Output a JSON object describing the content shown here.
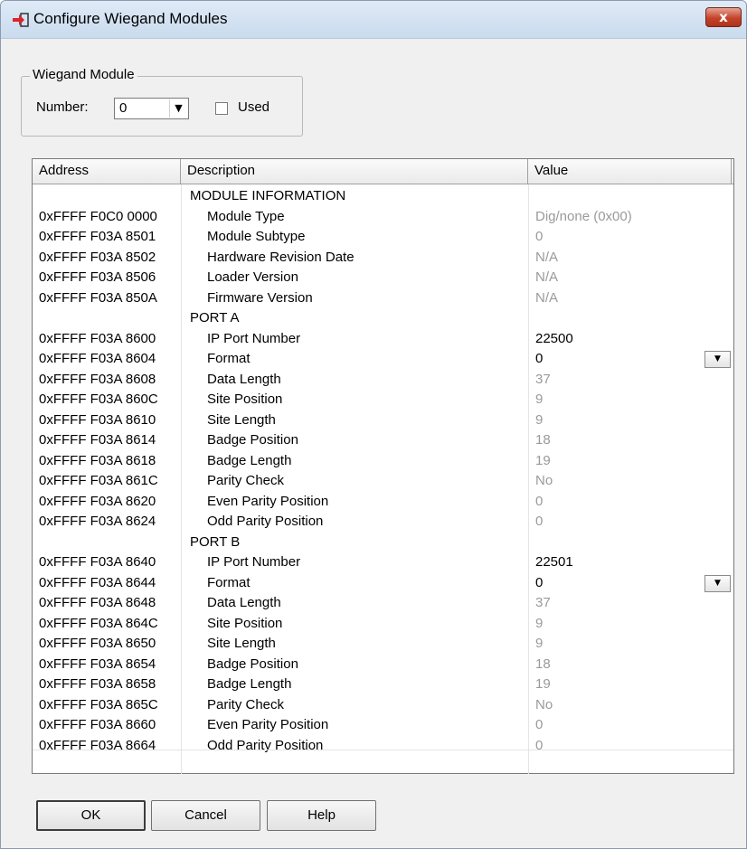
{
  "window": {
    "title": "Configure Wiegand Modules",
    "close_glyph": "x"
  },
  "module_group": {
    "title": "Wiegand Module",
    "number_label": "Number:",
    "number_value": "0",
    "used_label": "Used",
    "used_checked": false
  },
  "grid": {
    "headers": [
      "Address",
      "Description",
      "Value"
    ],
    "rows": [
      {
        "address": "",
        "description": "MODULE INFORMATION",
        "value": "",
        "type": "section"
      },
      {
        "address": "0xFFFF F0C0 0000",
        "description": "Module Type",
        "value": "Dig/none (0x00)",
        "type": "readonly"
      },
      {
        "address": "0xFFFF F03A 8501",
        "description": "Module Subtype",
        "value": "0",
        "type": "readonly"
      },
      {
        "address": "0xFFFF F03A 8502",
        "description": "Hardware Revision Date",
        "value": "N/A",
        "type": "readonly"
      },
      {
        "address": "0xFFFF F03A 8506",
        "description": "Loader Version",
        "value": "N/A",
        "type": "readonly"
      },
      {
        "address": "0xFFFF F03A 850A",
        "description": "Firmware Version",
        "value": "N/A",
        "type": "readonly"
      },
      {
        "address": "",
        "description": "PORT A",
        "value": "",
        "type": "section"
      },
      {
        "address": "0xFFFF F03A 8600",
        "description": "IP Port Number",
        "value": "22500",
        "type": "editable"
      },
      {
        "address": "0xFFFF F03A 8604",
        "description": "Format",
        "value": "0",
        "type": "dropdown"
      },
      {
        "address": "0xFFFF F03A 8608",
        "description": "Data Length",
        "value": "37",
        "type": "readonly"
      },
      {
        "address": "0xFFFF F03A 860C",
        "description": "Site Position",
        "value": "9",
        "type": "readonly"
      },
      {
        "address": "0xFFFF F03A 8610",
        "description": "Site Length",
        "value": "9",
        "type": "readonly"
      },
      {
        "address": "0xFFFF F03A 8614",
        "description": "Badge Position",
        "value": "18",
        "type": "readonly"
      },
      {
        "address": "0xFFFF F03A 8618",
        "description": "Badge Length",
        "value": "19",
        "type": "readonly"
      },
      {
        "address": "0xFFFF F03A 861C",
        "description": "Parity Check",
        "value": "No",
        "type": "readonly"
      },
      {
        "address": "0xFFFF F03A 8620",
        "description": "Even Parity Position",
        "value": "0",
        "type": "readonly"
      },
      {
        "address": "0xFFFF F03A 8624",
        "description": "Odd Parity Position",
        "value": "0",
        "type": "readonly"
      },
      {
        "address": "",
        "description": "PORT B",
        "value": "",
        "type": "section"
      },
      {
        "address": "0xFFFF F03A 8640",
        "description": "IP Port Number",
        "value": "22501",
        "type": "editable"
      },
      {
        "address": "0xFFFF F03A 8644",
        "description": "Format",
        "value": "0",
        "type": "dropdown"
      },
      {
        "address": "0xFFFF F03A 8648",
        "description": "Data Length",
        "value": "37",
        "type": "readonly"
      },
      {
        "address": "0xFFFF F03A 864C",
        "description": "Site Position",
        "value": "9",
        "type": "readonly"
      },
      {
        "address": "0xFFFF F03A 8650",
        "description": "Site Length",
        "value": "9",
        "type": "readonly"
      },
      {
        "address": "0xFFFF F03A 8654",
        "description": "Badge Position",
        "value": "18",
        "type": "readonly"
      },
      {
        "address": "0xFFFF F03A 8658",
        "description": "Badge Length",
        "value": "19",
        "type": "readonly"
      },
      {
        "address": "0xFFFF F03A 865C",
        "description": "Parity Check",
        "value": "No",
        "type": "readonly"
      },
      {
        "address": "0xFFFF F03A 8660",
        "description": "Even Parity Position",
        "value": "0",
        "type": "readonly"
      },
      {
        "address": "0xFFFF F03A 8664",
        "description": "Odd Parity Position",
        "value": "0",
        "type": "readonly"
      }
    ]
  },
  "buttons": {
    "ok": "OK",
    "cancel": "Cancel",
    "help": "Help"
  },
  "colors": {
    "readonly_text": "#9a9a9a",
    "close_button": "#c4442a",
    "title_icon": "#d8262a"
  }
}
